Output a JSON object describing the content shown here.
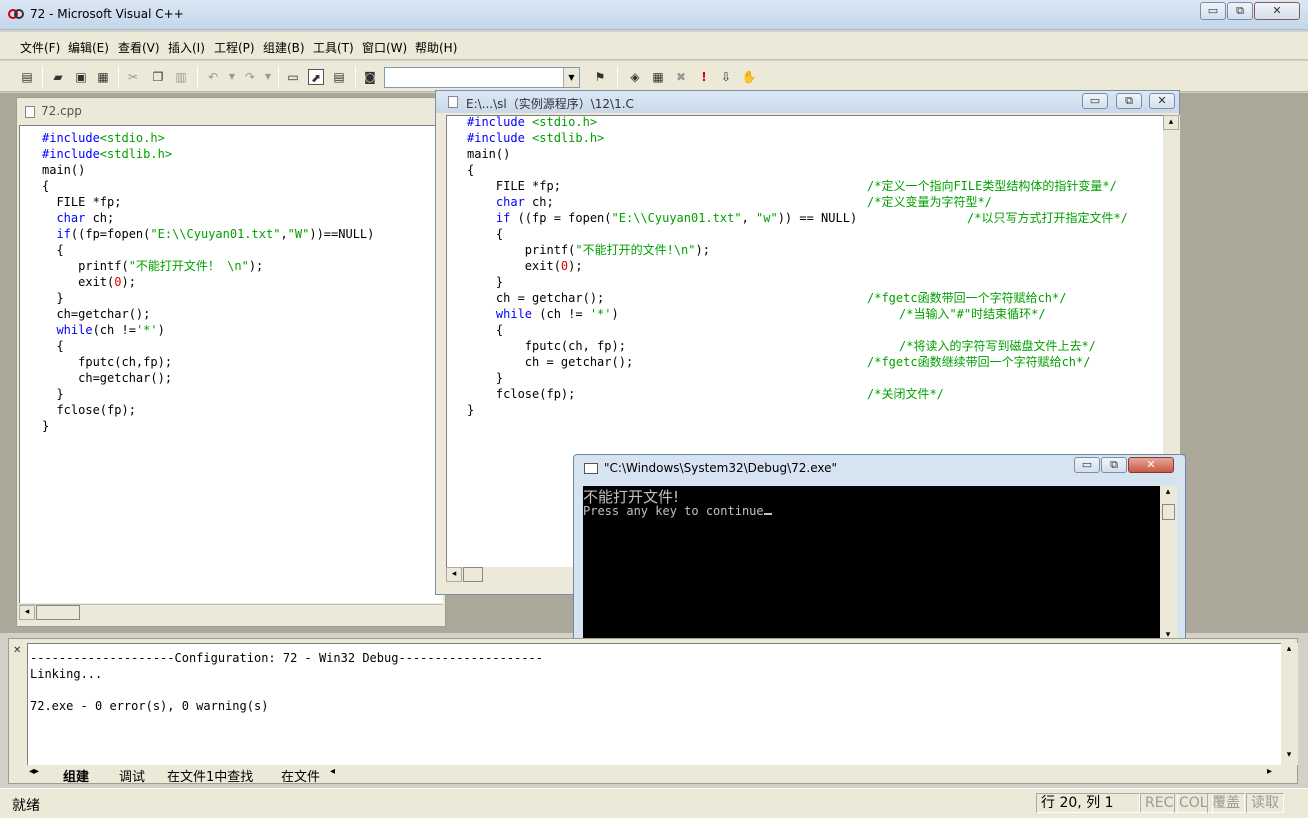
{
  "window": {
    "title": "72 - Microsoft Visual C++",
    "minimize": "▭",
    "restore": "⧉",
    "close": "✕"
  },
  "menu": [
    "文件(F)",
    "编辑(E)",
    "查看(V)",
    "插入(I)",
    "工程(P)",
    "组建(B)",
    "工具(T)",
    "窗口(W)",
    "帮助(H)"
  ],
  "toolbar": {
    "combo_value": "",
    "icons": [
      "new-file-icon",
      "open-icon",
      "save-icon",
      "save-all-icon",
      "cut-icon",
      "copy-icon",
      "paste-icon",
      "undo-icon",
      "redo-icon",
      "workspace-icon",
      "output-icon",
      "window-list-icon",
      "find-in-files-icon",
      "wizard-bar-icon",
      "compile-icon",
      "build-icon",
      "stop-build-icon",
      "execute-icon",
      "go-icon",
      "insert-breakpoint-icon"
    ]
  },
  "doc1": {
    "title": "72.cpp",
    "lines": [
      [
        "#include",
        "<stdio.h>"
      ],
      [
        "#include",
        "<stdlib.h>"
      ],
      [
        "main()"
      ],
      [
        "{"
      ],
      [
        "  FILE *fp;"
      ],
      [
        "  char ch;"
      ],
      [
        "  if((fp=fopen(\"E:\\\\Cyuyan01.txt\",\"W\"))==NULL)"
      ],
      [
        "  {"
      ],
      [
        "     printf(\"不能打开文件！ \\n\");"
      ],
      [
        "     exit(0);"
      ],
      [
        "  }"
      ],
      [
        "  ch=getchar();"
      ],
      [
        "  while(ch !='*')"
      ],
      [
        "  {"
      ],
      [
        "     fputc(ch,fp);"
      ],
      [
        "     ch=getchar();"
      ],
      [
        "  }"
      ],
      [
        "  fclose(fp);"
      ],
      [
        "}"
      ]
    ]
  },
  "doc2": {
    "title": "E:\\...\\sl（实例源程序）\\12\\1.C",
    "lines": [
      "#include <stdio.h>",
      "#include <stdlib.h>",
      "main()",
      "{",
      "    FILE *fp;",
      "    char ch;",
      "    if ((fp = fopen(\"E:\\\\Cyuyan01.txt\", \"w\")) == NULL)",
      "    {",
      "        printf(\"不能打开的文件!\\n\");",
      "        exit(0);",
      "    }",
      "    ch = getchar();",
      "    while (ch != '*')",
      "    {",
      "        fputc(ch, fp);",
      "        ch = getchar();",
      "    }",
      "    fclose(fp);",
      "}"
    ],
    "comments": [
      "/*定义一个指向FILE类型结构体的指针变量*/",
      "/*定义变量为字符型*/",
      "/*以只写方式打开指定文件*/",
      "/*fgetc函数带回一个字符赋给ch*/",
      "/*当输入\"#\"时结束循环*/",
      "/*将读入的字符写到磁盘文件上去*/",
      "/*fgetc函数继续带回一个字符赋给ch*/",
      "/*关闭文件*/"
    ]
  },
  "console": {
    "title": "\"C:\\Windows\\System32\\Debug\\72.exe\"",
    "line1": "不能打开文件!",
    "line2": "Press any key to continue"
  },
  "output": {
    "line1": "--------------------Configuration: 72 - Win32 Debug--------------------",
    "line2": "Linking...",
    "line3": "",
    "line4": "72.exe - 0 error(s), 0 warning(s)",
    "tabs": [
      "组建",
      "调试",
      "在文件1中查找",
      "在文件"
    ]
  },
  "status": {
    "text": "就绪",
    "position": "行 20, 列 1",
    "rec": "REC",
    "col": "COL",
    "ovr": "覆盖",
    "read": "读取"
  }
}
